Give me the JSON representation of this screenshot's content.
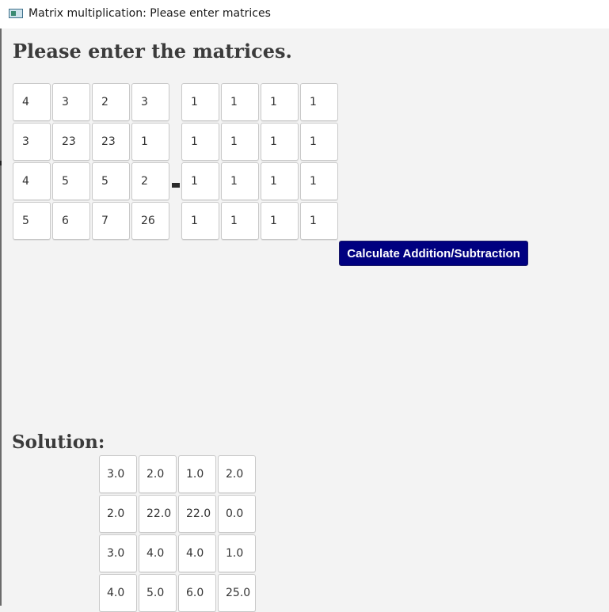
{
  "window": {
    "title": "Matrix multiplication: Please enter matrices"
  },
  "heading": "Please enter the matrices.",
  "matrix_a": [
    [
      "4",
      "3",
      "2",
      "3"
    ],
    [
      "3",
      "23",
      "23",
      "1"
    ],
    [
      "4",
      "5",
      "5",
      "2"
    ],
    [
      "5",
      "6",
      "7",
      "26"
    ]
  ],
  "operator": "-",
  "matrix_b": [
    [
      "1",
      "1",
      "1",
      "1"
    ],
    [
      "1",
      "1",
      "1",
      "1"
    ],
    [
      "1",
      "1",
      "1",
      "1"
    ],
    [
      "1",
      "1",
      "1",
      "1"
    ]
  ],
  "calculate_button": "Calculate Addition/Subtraction",
  "solution_heading": "Solution:",
  "solution": [
    [
      "3.0",
      "2.0",
      "1.0",
      "2.0"
    ],
    [
      "2.0",
      "22.0",
      "22.0",
      "0.0"
    ],
    [
      "3.0",
      "4.0",
      "4.0",
      "1.0"
    ],
    [
      "4.0",
      "5.0",
      "6.0",
      "25.0"
    ]
  ],
  "colors": {
    "button_bg": "#000080",
    "button_text": "#ffffff",
    "background": "#f3f3f3"
  }
}
